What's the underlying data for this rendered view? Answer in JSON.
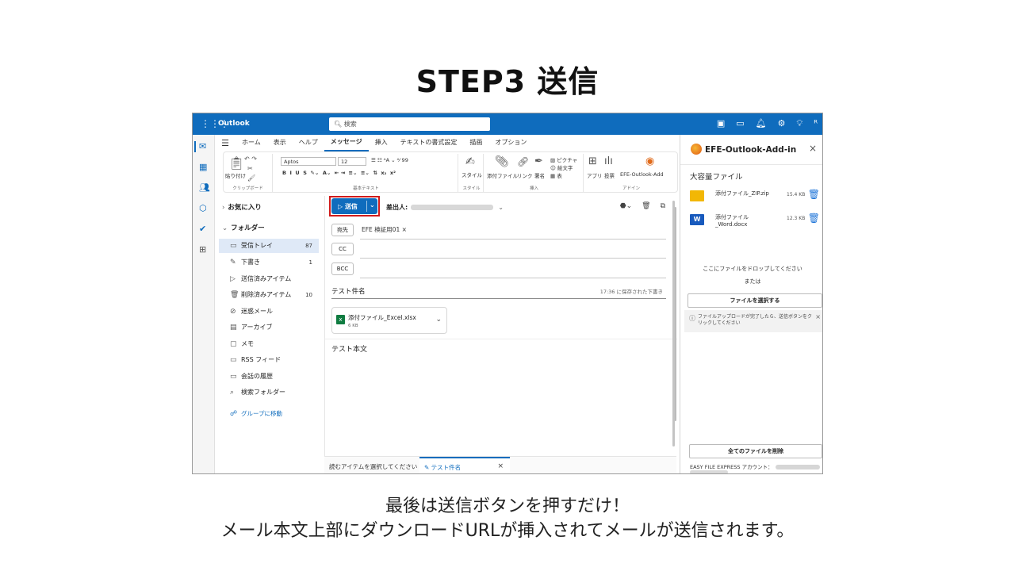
{
  "slide": {
    "title": "STEP3 送信",
    "caption_line1": "最後は送信ボタンを押すだけ！",
    "caption_line2": "メール本文上部にダウンロードURLが挿入されてメールが送信されます。"
  },
  "topbar": {
    "brand": "Outlook",
    "search_placeholder": "検索",
    "accent": "#0f6cbd"
  },
  "ribbon": {
    "tabs": [
      "ホーム",
      "表示",
      "ヘルプ",
      "メッセージ",
      "挿入",
      "テキストの書式設定",
      "描画",
      "オプション"
    ],
    "selected_tab": "メッセージ",
    "paste_label": "貼り付け",
    "clipboard_group": "クリップボード",
    "font_name": "Aptos",
    "font_size": "12",
    "basic_text_group": "基本テキスト",
    "style_label": "スタイル",
    "style_group": "スタイル",
    "attach_label": "添付ファイル",
    "link_label": "リンク",
    "signature_label": "署名",
    "picture_label": "ピクチャ",
    "emoji_label": "絵文字",
    "table_label": "表",
    "insert_group": "挿入",
    "apps_label": "アプリ",
    "poll_label": "投票",
    "addin_label": "EFE-Outlook-Add",
    "addin_group": "アドイン"
  },
  "folders": {
    "favorites": "お気に入り",
    "folders_header": "フォルダー",
    "items": [
      {
        "label": "受信トレイ",
        "count": "87",
        "icon": "inbox-icon"
      },
      {
        "label": "下書き",
        "count": "1",
        "icon": "pencil-icon"
      },
      {
        "label": "送信済みアイテム",
        "count": "",
        "icon": "send-icon"
      },
      {
        "label": "削除済みアイテム",
        "count": "10",
        "icon": "trash-icon"
      },
      {
        "label": "迷惑メール",
        "count": "",
        "icon": "junk-icon"
      },
      {
        "label": "アーカイブ",
        "count": "",
        "icon": "archive-icon"
      },
      {
        "label": "メモ",
        "count": "",
        "icon": "note-icon"
      },
      {
        "label": "RSS フィード",
        "count": "",
        "icon": "folder-icon"
      },
      {
        "label": "会話の履歴",
        "count": "",
        "icon": "folder-icon"
      },
      {
        "label": "検索フォルダー",
        "count": "",
        "icon": "search-folder-icon"
      }
    ],
    "group_link": "グループに移動"
  },
  "compose": {
    "send_label": "送信",
    "from_label": "差出人:",
    "to_label": "宛先",
    "to_chip": "EFE 検証用01",
    "cc_label": "CC",
    "bcc_label": "BCC",
    "subject": "テスト件名",
    "saved_text": "17:36 に保存された下書き",
    "attachment_name": "添付ファイル_Excel.xlsx",
    "attachment_size": "6 KB",
    "body": "テスト本文"
  },
  "bottombar": {
    "left_text": "読むアイテムを選択してください",
    "draft_tab": "テスト件名"
  },
  "addin": {
    "title": "EFE-Outlook-Add-in",
    "section_title": "大容量ファイル",
    "files": [
      {
        "name": "添付ファイル_ZIP.zip",
        "size": "15.4 KB",
        "type": "zip"
      },
      {
        "name_line1": "添付ファイル",
        "name_line2": "_Word.docx",
        "size": "12.3 KB",
        "type": "word"
      }
    ],
    "drop_text": "ここにファイルをドロップしてください",
    "or_text": "または",
    "select_button": "ファイルを選択する",
    "info_text": "ファイルアップロードが完了したら、送信ボタンをクリックしてください",
    "delete_all_button": "全てのファイルを削除",
    "account_label": "EASY FILE EXPRESS アカウント："
  }
}
